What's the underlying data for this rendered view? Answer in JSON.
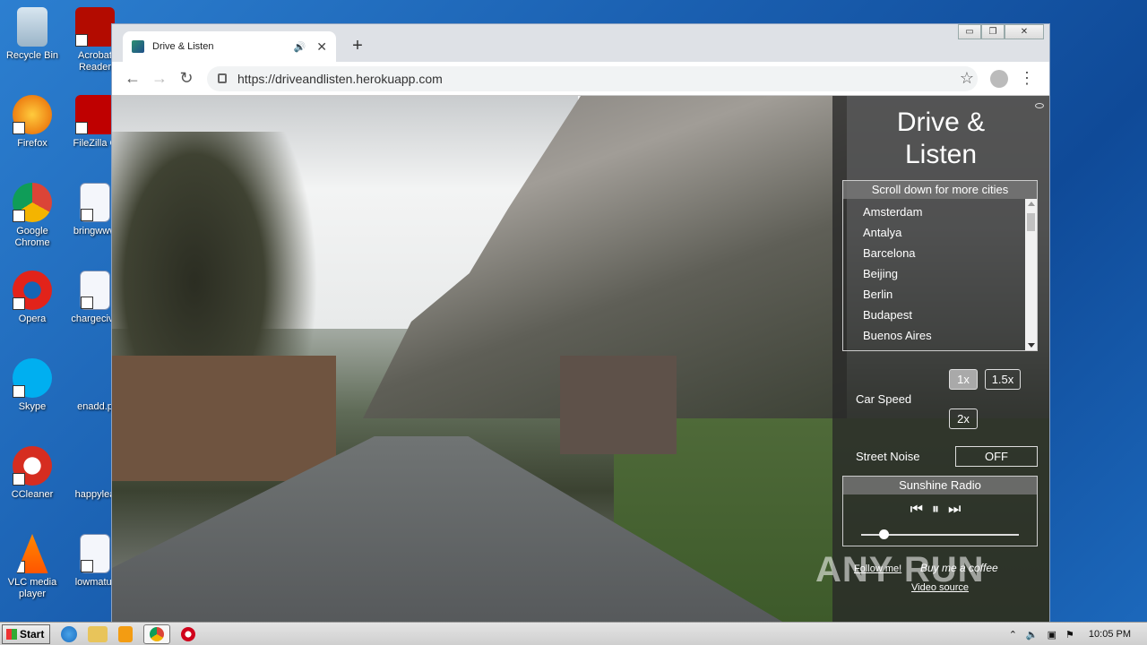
{
  "desktop": {
    "icons": [
      {
        "label": "Recycle Bin",
        "icon": "recycle-bin-icon"
      },
      {
        "label": "Acrobat Reader",
        "icon": "acrobat-icon"
      },
      {
        "label": "Firefox",
        "icon": "firefox-icon"
      },
      {
        "label": "FileZilla C",
        "icon": "filezilla-icon"
      },
      {
        "label": "Google Chrome",
        "icon": "chrome-icon"
      },
      {
        "label": "bringwww",
        "icon": "word-doc-icon"
      },
      {
        "label": "Opera",
        "icon": "opera-icon"
      },
      {
        "label": "chargecive",
        "icon": "word-doc-icon"
      },
      {
        "label": "Skype",
        "icon": "skype-icon"
      },
      {
        "label": "enadd.p",
        "icon": "file-icon"
      },
      {
        "label": "CCleaner",
        "icon": "ccleaner-icon"
      },
      {
        "label": "happylea",
        "icon": "file-icon"
      },
      {
        "label": "VLC media player",
        "icon": "vlc-icon"
      },
      {
        "label": "lowmatur",
        "icon": "word-doc-icon"
      }
    ]
  },
  "browser": {
    "tab_title": "Drive & Listen",
    "url": "https://driveandlisten.herokuapp.com",
    "new_tab": "+",
    "win_min": "▭",
    "win_max": "❐",
    "win_close": "✕"
  },
  "app": {
    "title": "Drive & Listen",
    "city_header": "Scroll down for more cities",
    "cities": [
      "Amsterdam",
      "Antalya",
      "Barcelona",
      "Beijing",
      "Berlin",
      "Budapest",
      "Buenos Aires"
    ],
    "speed_label": "Car Speed",
    "speed_options": [
      "1x",
      "1.5x",
      "2x"
    ],
    "speed_selected": "1x",
    "noise_label": "Street Noise",
    "noise_value": "OFF",
    "radio_name": "Sunshine Radio",
    "volume_fraction": 0.14,
    "follow_link": "Follow me!",
    "coffee_text": "Buy me a coffee",
    "video_source": "Video source"
  },
  "taskbar": {
    "start_label": "Start",
    "clock": "10:05 PM"
  },
  "watermark": "ANY RUN"
}
